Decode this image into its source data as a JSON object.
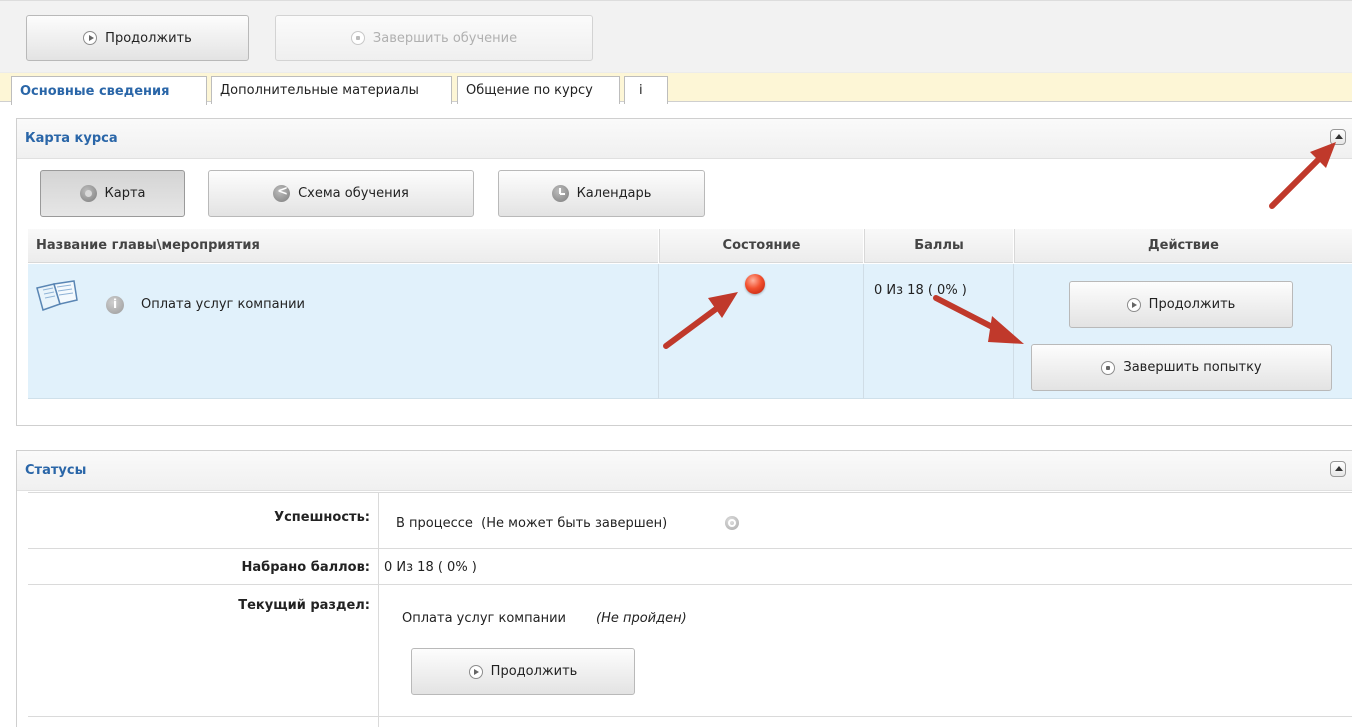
{
  "toolbar": {
    "continue_label": "Продолжить",
    "finish_learning_label": "Завершить обучение"
  },
  "tabs": [
    {
      "label": "Основные сведения"
    },
    {
      "label": "Дополнительные материалы"
    },
    {
      "label": "Общение по курсу"
    },
    {
      "label": "i"
    }
  ],
  "course_map": {
    "title": "Карта курса",
    "view_buttons": {
      "map": "Карта",
      "scheme": "Схема обучения",
      "calendar": "Календарь"
    },
    "columns": {
      "name": "Название главы\\мероприятия",
      "state": "Состояние",
      "score": "Баллы",
      "action": "Действие"
    },
    "row": {
      "name": "Оплата услуг компании",
      "state_color": "#e8321a",
      "score": "0 Из 18 ( 0% )",
      "continue_label": "Продолжить",
      "finish_attempt_label": "Завершить попытку"
    }
  },
  "statuses": {
    "title": "Статусы",
    "success_label": "Успешность:",
    "success_value": "В процессе  (Не может быть завершен)",
    "score_label": "Набрано баллов:",
    "score_value": "0 Из 18 ( 0% )",
    "section_label": "Текущий раздел:",
    "section_name": "Оплата услуг компании",
    "section_state": "(Не пройден)",
    "continue_label": "Продолжить"
  },
  "colors": {
    "accent": "#2a66a8",
    "arrow": "#c0392b",
    "row_highlight": "#e1f1fb",
    "tab_strip": "#fdf6d6"
  }
}
